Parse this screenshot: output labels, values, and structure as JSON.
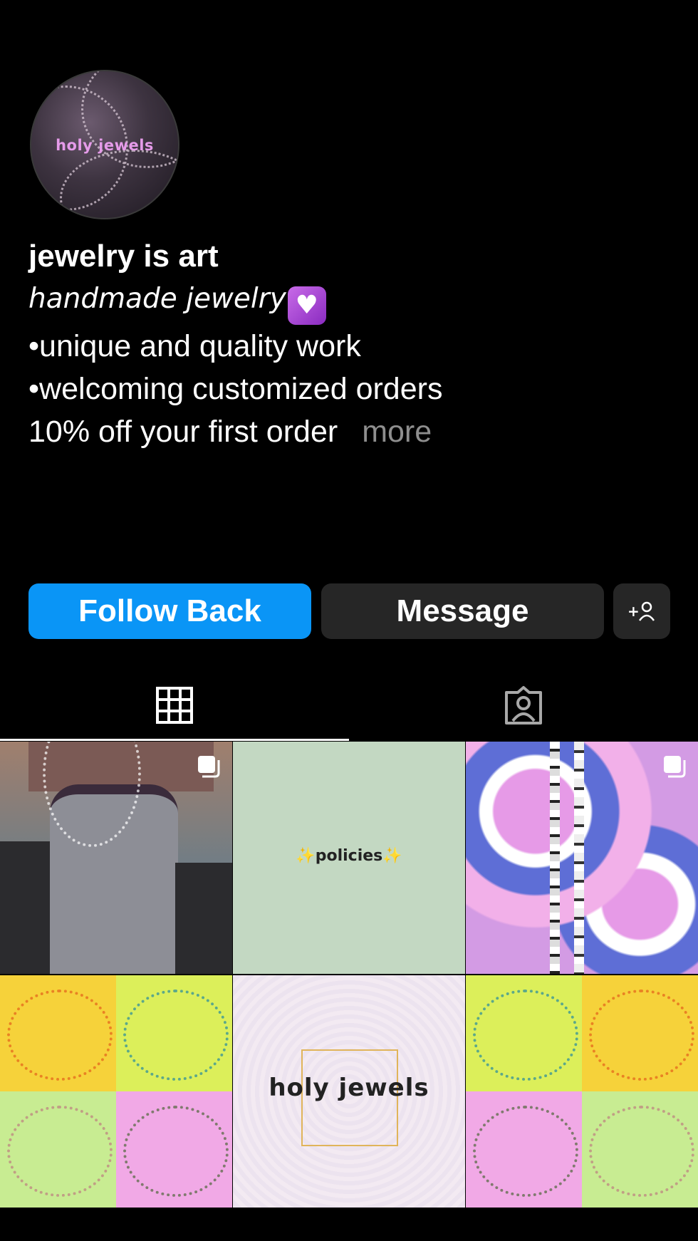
{
  "profile": {
    "avatar_label": "holy jewels",
    "display_name": "jewelry is art",
    "bio_line1": "handmade  jewelry",
    "bio_line2": "•unique and quality work",
    "bio_line3": "•welcoming customized orders",
    "bio_line4": "10% off your first order",
    "more_label": "more"
  },
  "actions": {
    "follow_back_label": "Follow Back",
    "message_label": "Message",
    "add_user_icon": "add-person-icon"
  },
  "tabs": [
    {
      "name": "posts",
      "icon": "grid-icon",
      "active": true
    },
    {
      "name": "tagged",
      "icon": "tagged-person-icon",
      "active": false
    }
  ],
  "posts": [
    {
      "label": "",
      "multi": true
    },
    {
      "label": "✨policies✨",
      "multi": false
    },
    {
      "label": "",
      "multi": true
    },
    {
      "label": "",
      "multi": false
    },
    {
      "label": "holy jewels",
      "multi": false
    },
    {
      "label": "",
      "multi": false
    }
  ],
  "colors": {
    "follow_button": "#0a95f6",
    "secondary_button": "#262626",
    "background": "#000000",
    "muted_text": "#8e8e8e"
  }
}
